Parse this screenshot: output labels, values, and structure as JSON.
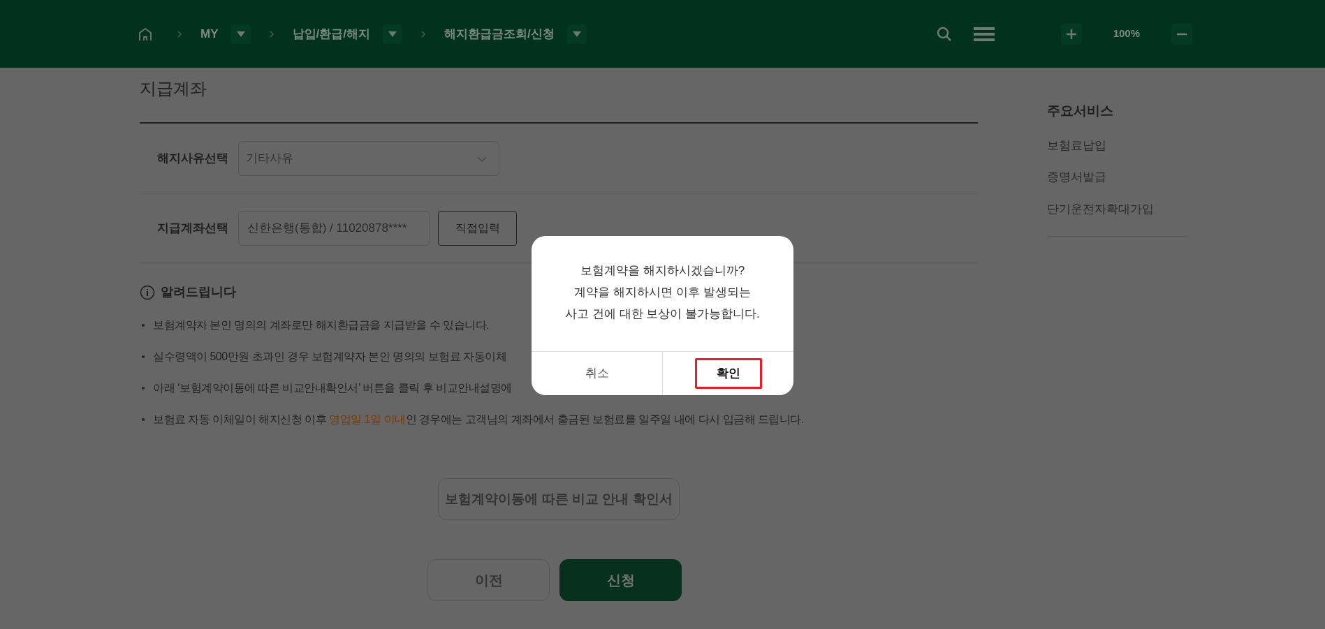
{
  "breadcrumb": [
    {
      "label": "MY"
    },
    {
      "label": "납입/환급/해지"
    },
    {
      "label": "해지환급금조회/신청"
    }
  ],
  "zoom": {
    "reading": "100%"
  },
  "section_title": "지급계좌",
  "form": [
    {
      "kind": "select",
      "label": "해지사유선택",
      "value": "기타사유"
    },
    {
      "kind": "account",
      "label": "지급계좌선택",
      "value": "신한은행(통합) / 11020878****",
      "button": "직접입력"
    }
  ],
  "notice": {
    "title": "알려드립니다",
    "items": [
      "보험계약자 본인 명의의 계좌로만 해지환급금을 지급받을 수 있습니다.",
      "실수령액이 500만원 초과인 경우 보험계약자 본인 명의의 보험료 자동이체",
      "아래 ‘보험계약이동에 따른 비교안내확인서’ 버튼을 클릭 후 비교안내설명에",
      "보험료 자동 이체일이 해지신청 이후 **영업일 1일 이내**인 경우에는 고객님의 계좌에서 출금된 보험료를 일주일 내에 다시 입금해 드립니다."
    ]
  },
  "compare_button": "보험계약이동에 따른 비교 안내 확인서",
  "actions": [
    {
      "label": "이전",
      "kind": "secondary"
    },
    {
      "label": "신청",
      "kind": "primary"
    }
  ],
  "sidebar": {
    "title": "주요서비스",
    "items": [
      "보험료납입",
      "증명서발급",
      "단기운전자확대가입"
    ]
  },
  "dialog": {
    "lines": [
      "보험계약을 해지하시겠습니까?",
      "계약을 해지하시면 이후 발생되는",
      "사고 건에 대한 보상이 불가능합니다."
    ],
    "buttons": [
      {
        "label": "취소",
        "highlighted": false
      },
      {
        "label": "확인",
        "highlighted": true
      }
    ]
  }
}
